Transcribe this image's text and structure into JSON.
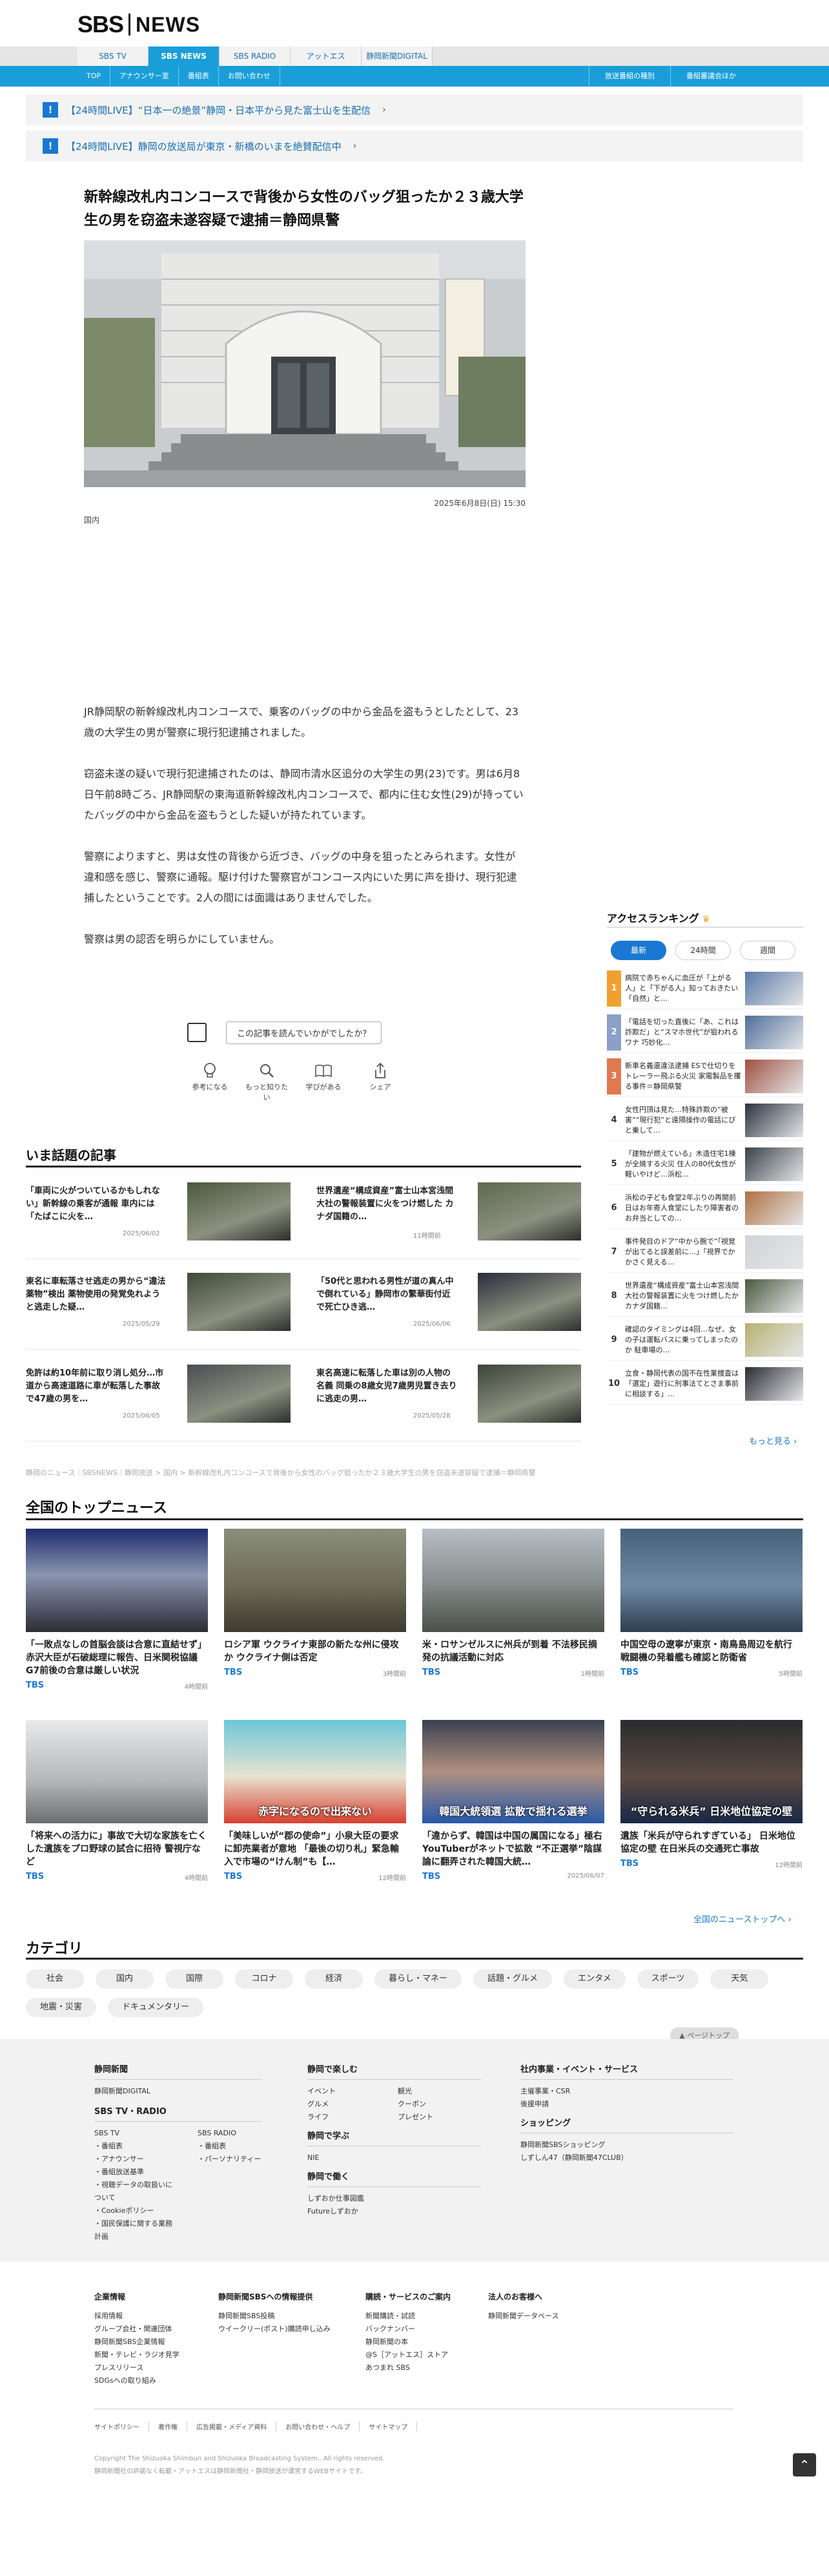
{
  "header": {
    "logo_sbs": "SBS",
    "logo_news": "NEWS"
  },
  "nav_primary": [
    {
      "label": "SBS TV",
      "active": false
    },
    {
      "label": "SBS NEWS",
      "active": true
    },
    {
      "label": "SBS RADIO",
      "active": false
    },
    {
      "label": "アットエス",
      "active": false
    },
    {
      "label": "静岡新聞DIGITAL",
      "active": false
    }
  ],
  "nav_secondary": [
    "TOP",
    "アナウンサー室",
    "番組表",
    "お問い合わせ"
  ],
  "nav_secondary_right": [
    "放送番組の種別",
    "番組審議会ほか"
  ],
  "alerts": [
    {
      "text": "【24時間LIVE】“日本一の絶景”静岡・日本平から見た富士山を生配信"
    },
    {
      "text": "【24時間LIVE】静岡の放送局が東京・新橋のいまを絶賛配信中"
    }
  ],
  "article": {
    "title": "新幹線改札内コンコースで背後から女性のバッグ狙ったか２３歳大学生の男を窃盗未遂容疑で逮捕＝静岡県警",
    "date": "2025年6月8日(日) 15:30",
    "category": "国内",
    "paragraphs": [
      "JR静岡駅の新幹線改札内コンコースで、乗客のバッグの中から金品を盗もうとしたとして、23歳の大学生の男が警察に現行犯逮捕されました。",
      "窃盗未遂の疑いで現行犯逮捕されたのは、静岡市清水区追分の大学生の男(23)です。男は6月8日午前8時ごろ、JR静岡駅の東海道新幹線改札内コンコースで、都内に住む女性(29)が持っていたバッグの中から金品を盗もうとした疑いが持たれています。",
      "警察によりますと、男は女性の背後から近づき、バッグの中身を狙ったとみられます。女性が違和感を感じ、警察に通報。駆け付けた警察官がコンコース内にいた男に声を掛け、現行犯逮捕したということです。2人の間には面識はありませんでした。",
      "警察は男の認否を明らかにしていません。"
    ],
    "feedback_label": "この記事を読んでいかがでしたか？",
    "reactions": [
      "参考になる",
      "もっと知りたい",
      "学びがある",
      "シェア"
    ]
  },
  "trending": {
    "heading": "いま話題の記事",
    "items": [
      {
        "title": "「車両に火がついているかもしれない」新幹線の乗客が通報 車内には「たばこに火を…",
        "date": "2025/06/02"
      },
      {
        "title": "世界遺産“構成資産”富士山本宮浅間大社の警報装置に火をつけ燃した カナダ国籍の…",
        "date": "11時間前"
      },
      {
        "title": "東名に車転落させ逃走の男から“違法薬物”検出 薬物使用の発覚免れようと逃走した疑…",
        "date": "2025/05/29"
      },
      {
        "title": "「50代と思われる男性が道の真ん中で倒れている」静岡市の繁華街付近で死亡ひき逃…",
        "date": "2025/06/06"
      },
      {
        "title": "免許は約10年前に取り消し処分…市道から高速道路に車が転落した事故で47歳の男を…",
        "date": "2025/06/05"
      },
      {
        "title": "東名高速に転落した車は別の人物の名義 同乗の8歳女児7歳男児置き去りに逃走の男…",
        "date": "2025/05/28"
      }
    ]
  },
  "breadcrumbs": "静岡のニュース｜SBSNEWS｜静岡放送 > 国内 > 新幹線改札内コンコースで背後から女性のバッグ狙ったか２３歳大学生の男を窃盗未遂容疑で逮捕＝静岡県警",
  "ranking": {
    "heading": "アクセスランキング",
    "tabs": [
      "最新",
      "24時間",
      "週間"
    ],
    "items": [
      {
        "num": "1",
        "text": "病院で赤ちゃんに血圧が「上がる人」と「下がる人」知っておきたい「自然」と…"
      },
      {
        "num": "2",
        "text": "「電話を切った直後に「あ、これは詐欺だ」と“スマホ世代”が狙われるワナ 巧妙化…"
      },
      {
        "num": "3",
        "text": "新車名義還違法逮捕 ESで仕切りをトレーラー飛ぶる火災 家電製品を攫る事件＝静岡県警"
      },
      {
        "num": "4",
        "text": "女性円頂は見た…特殊詐欺の“被害”“現行犯”と遠隔操作の電話にぴと乗して…"
      },
      {
        "num": "5",
        "text": "「建物が燃えている」木造住宅1棟が全焼する火災 住人の80代女性が軽いやけど…浜松…"
      },
      {
        "num": "6",
        "text": "浜松の子ども食堂2年ぶりの再開前日はお年寄人食堂にしたり障害者のお弁当としての…"
      },
      {
        "num": "7",
        "text": "事件発目のドア“中から腕で”「視覚が出てると誤差前に…」「視界でかかさく見える…"
      },
      {
        "num": "8",
        "text": "世界遺産“構成資産”富士山本宮浅間大社の警報装置に火をつけ燃したか カナダ国籍…"
      },
      {
        "num": "9",
        "text": "確認のタイミングは4回…なぜ、女の子は運転バスに乗ってしまったのか 駐車場の…"
      },
      {
        "num": "10",
        "text": "立食・静岡代表の国不在性業捜査は「選定」遊行に刑事法てとさま事前に相談する」…"
      }
    ],
    "more": "もっと見る ›"
  },
  "top_news": {
    "heading": "全国のトップニュース",
    "items": [
      {
        "title": "「一敗点なしの首脳会談は合意に直結せず」赤沢大臣が石破総理に報告、日米関税協議 G7前後の合意は厳しい状況",
        "source": "TBS",
        "date": "4時間前"
      },
      {
        "title": "ロシア軍 ウクライナ東部の新たな州に侵攻か ウクライナ側は否定",
        "source": "TBS",
        "date": "3時間前"
      },
      {
        "title": "米・ロサンゼルスに州兵が到着 不法移民摘発の抗議活動に対応",
        "source": "TBS",
        "date": "1時間前"
      },
      {
        "title": "中国空母の遼寧が東京・南鳥島周辺を航行 戦闘機の発着艦も確認と防衛省",
        "source": "TBS",
        "date": "5時間前"
      },
      {
        "title": "「将来への活力に」事故で大切な家族を亡くした遺族をプロ野球の試合に招待 警視庁など",
        "source": "TBS",
        "date": "4時間前"
      },
      {
        "title": "「美味しいが“郡の使命”」小泉大臣の要求に卸売業者が意地 「最後の切り札」緊急輸入で市場の“けん制”も【…",
        "source": "TBS",
        "date": "12時間前"
      },
      {
        "title": "「違からず、韓国は中国の属国になる」極右YouTuberがネットで拡散 “不正選挙”陰謀論に翻弄された韓国大統…",
        "source": "TBS",
        "date": "2025/06/07"
      },
      {
        "title": "遺族「米兵が守られすぎている」 日米地位協定の壁 在日米兵の交通死亡事故",
        "source": "TBS",
        "date": "12時間前"
      }
    ],
    "more": "全国のニューストップへ ›",
    "thumb_captions": [
      "",
      "",
      "",
      "",
      "",
      "赤字になるので出来ない",
      "韓国大統領選 拡散で揺れる選挙",
      "“守られる米兵” 日米地位協定の壁"
    ]
  },
  "categories": {
    "heading": "カテゴリ",
    "items": [
      "社会",
      "国内",
      "国際",
      "コロナ",
      "経済",
      "暮らし・マネー",
      "話題・グルメ",
      "エンタメ",
      "スポーツ",
      "天気",
      "地震・災害",
      "ドキュメンタリー"
    ]
  },
  "page_top": "▲ ページトップ",
  "footer": {
    "col1_h": "静岡新聞",
    "col1_items": [
      "静岡新聞DIGITAL"
    ],
    "col1b_h": "SBS TV・RADIO",
    "col1b_left": [
      "SBS TV",
      "・番組表",
      "・アナウンサー",
      "・番組放送基準",
      "・視聴データの取扱いについて",
      "・Cookieポリシー",
      "・国民保護に関する業務計画"
    ],
    "col1b_right": [
      "SBS RADIO",
      "・番組表",
      "・パーソナリティー"
    ],
    "col2_h": "静岡で楽しむ",
    "col2_items": [
      "イベント",
      "観光",
      "グルメ",
      "クーポン",
      "ライフ",
      "プレゼント"
    ],
    "col2b_h": "静岡で学ぶ",
    "col2b_items": [
      "NIE"
    ],
    "col2c_h": "静岡で働く",
    "col2c_items": [
      "しずおか仕事図鑑",
      "Futureしずおか"
    ],
    "col3_h": "社内事業・イベント・サービス",
    "col3_items": [
      "主催事業・CSR",
      "後援申請"
    ],
    "col3b_h": "ショッピング",
    "col3b_items": [
      "静岡新聞SBSショッピング",
      "しずしん47（静岡新聞47CLUB）"
    ],
    "f2": [
      {
        "h": "企業情報",
        "items": [
          "採用情報",
          "グループ会社・関連団体",
          "静岡新聞SBS企業情報",
          "新聞・テレビ・ラジオ見学",
          "プレスリリース",
          "SDGsへの取り組み"
        ]
      },
      {
        "h": "静岡新聞SBSへの情報提供",
        "items": [
          "静岡新聞SBS投稿",
          "ウイークリー(ポスト)購読申し込み"
        ]
      },
      {
        "h": "購読・サービスのご案内",
        "items": [
          "新聞購読・試読",
          "バックナンバー",
          "静岡新聞の本",
          "@S［アットエス］ストア",
          "あつまれ SBS"
        ]
      },
      {
        "h": "法人のお客様へ",
        "items": [
          "静岡新聞データベース"
        ]
      }
    ],
    "links": [
      "サイトポリシー",
      "著作権",
      "広告掲載・メディア資料",
      "お問い合わせ・ヘルプ",
      "サイトマップ"
    ],
    "copyright": "Copyright The Shizuoka Shimbun and Shizuoka Broadcasting System., All rights reserved.",
    "copyright2": "静岡新聞社の許諾なく転載・アットエスは静岡新聞社・静岡放送が運営するWEBサイトです。"
  },
  "colors": {
    "accent": "#1a9ed9",
    "link": "#1a78d2",
    "rank": [
      "#f0a030",
      "#8aa0c8",
      "#e07850"
    ]
  }
}
